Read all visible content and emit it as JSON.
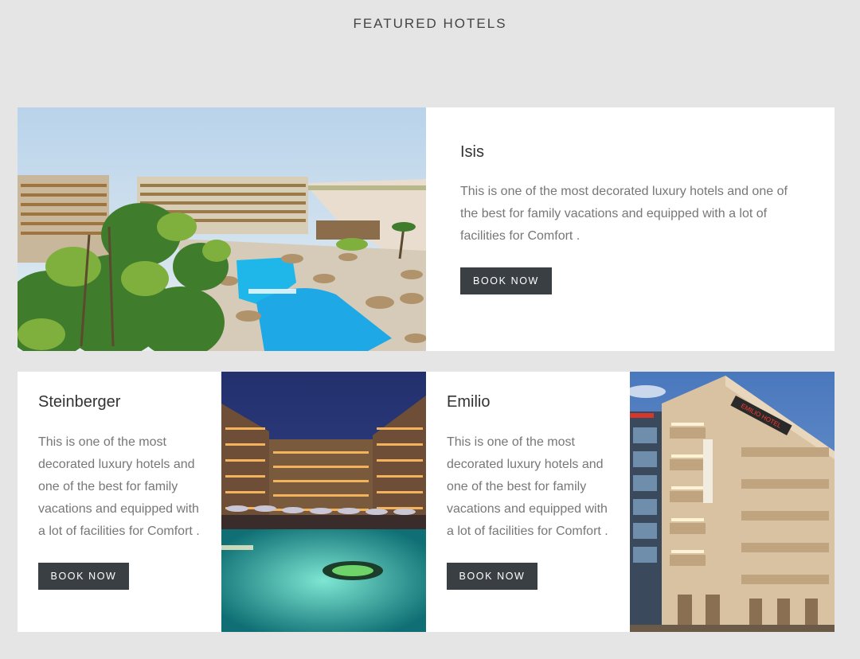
{
  "section": {
    "title": "FEATURED HOTELS"
  },
  "hotels": [
    {
      "name": "Isis",
      "description_lines": [
        "This is one of the most decorated luxury hotels and one of",
        "the best for family vacations and equipped with a lot of",
        "facilities for Comfort ."
      ],
      "button_label": "BOOK NOW"
    },
    {
      "name": "Steinberger",
      "description_lines": [
        "This is one of the most",
        "decorated luxury hotels and",
        "one of the best for family",
        "vacations and equipped with",
        "a lot of facilities for Comfort ."
      ],
      "button_label": "BOOK NOW"
    },
    {
      "name": "Emilio",
      "description_lines": [
        "This is one of the most",
        "decorated luxury hotels and",
        "one of the best for family",
        "vacations and equipped with",
        "a lot of facilities for Comfort ."
      ],
      "button_label": "BOOK NOW",
      "sign_text": "EMILIO HOTEL"
    }
  ],
  "colors": {
    "page_background": "#e5e5e5",
    "card_background": "#ffffff",
    "button_background": "#3a3f44",
    "pool_blue": "#1fb6ea",
    "pool_green": "#5fd6c2",
    "sky_blue": "#5b88c6"
  }
}
